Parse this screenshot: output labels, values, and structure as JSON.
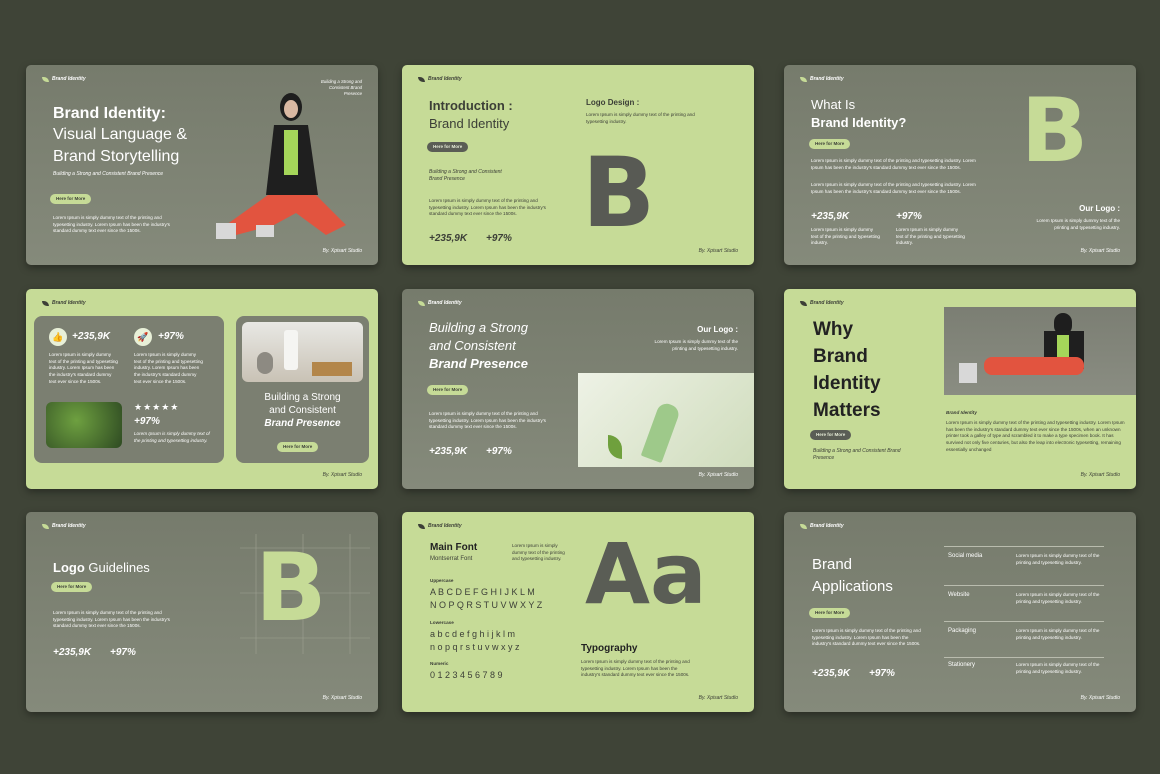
{
  "brand_tag": "Brand Identity",
  "footer": "By. Xpisart Studio",
  "pill": "Here for More",
  "lorem_a": "Lorem Ipsum is simply dummy text of the printing and typesetting industry.",
  "lorem_b": "Lorem Ipsum is simply dummy text of the printing and typesetting industry. Lorem Ipsum has been the industry's standard dummy text ever since the 1500s.",
  "lorem_long": "Lorem Ipsum is simply dummy text of the printing and typesetting industry. Lorem Ipsum has been the industry's standard dummy text ever since the 1500s, when an unknown printer took a galley of type and scrambled it to make a type specimen book. It has survived not only five centuries, but also the leap into electronic typesetting, remaining essentially unchanged",
  "stat1": "+235,9K",
  "stat2": "+97%",
  "s1": {
    "title1": "Brand Identity:",
    "title2": "Visual Language &",
    "title3": "Brand Storytelling",
    "subtitle": "Building a Strong and Consistent Brand Presence",
    "corner": "Building a Strong and Consistent Brand Presence"
  },
  "s2": {
    "title1": "Introduction :",
    "title2": "Brand Identity",
    "subtitle": "Building a Strong and Consistent Brand Presence",
    "logo_design": "Logo Design :",
    "letter": "B"
  },
  "s3": {
    "title1": "What Is",
    "title2": "Brand Identity?",
    "our_logo": "Our Logo :",
    "letter": "B"
  },
  "s4": {
    "stars": "★★★★★",
    "line1": "Building a Strong",
    "line2": "and Consistent",
    "line3": "Brand Presence"
  },
  "s5": {
    "line1": "Building a Strong",
    "line2": "and Consistent",
    "line3": "Brand Presence",
    "our_logo": "Our Logo :"
  },
  "s6": {
    "title1": "Why",
    "title2": "Brand",
    "title3": "Identity",
    "title4": "Matters",
    "tag": "Brand Identity",
    "subtitle": "Building a Strong and Consistent Brand Presence"
  },
  "s7": {
    "title_bold": "Logo",
    "title_light": " Guidelines",
    "letter": "B"
  },
  "s8": {
    "main_font": "Main Font",
    "font_name": "Montserrat Font",
    "upper_label": "Uppercase",
    "upper1": "A B C D E F G H I J K L M",
    "upper2": "N O P Q R S T U V W X Y Z",
    "lower_label": "Lowercase",
    "lower1": "a b c d e f g h i j k l m",
    "lower2": "n o p q r s t u v w x y z",
    "numeric_label": "Numeric",
    "numeric": "0 1 2 3 4 5 6 7 8 9",
    "sample": "Aa",
    "typography": "Typography"
  },
  "s9": {
    "title1": "Brand",
    "title2": "Applications",
    "items": [
      "Social media",
      "Website",
      "Packaging",
      "Stationery"
    ]
  }
}
